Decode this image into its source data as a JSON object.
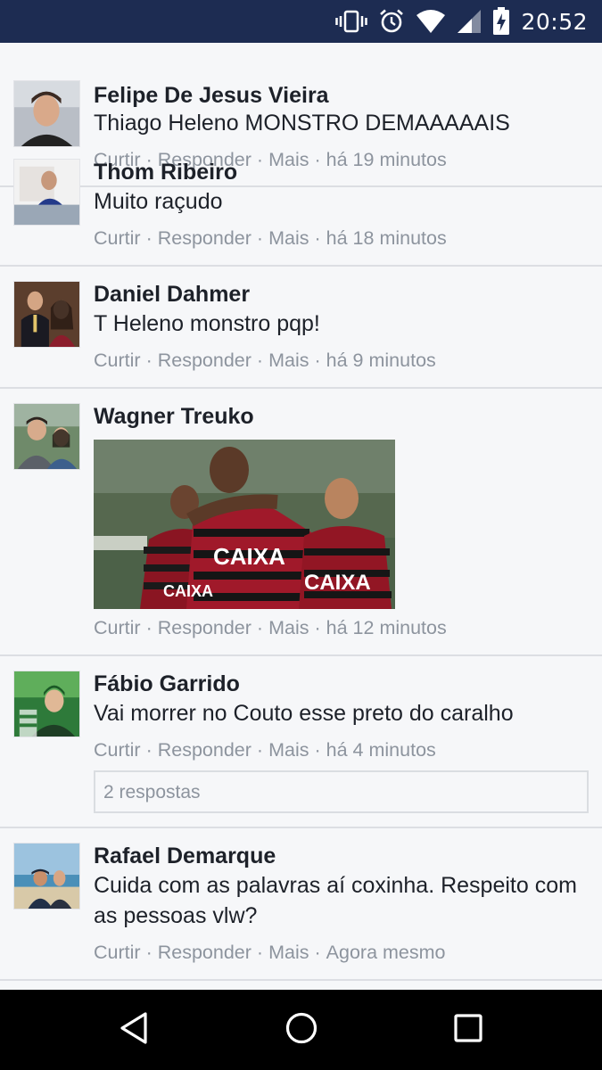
{
  "status_bar": {
    "time": "20:52",
    "icons": [
      "vibrate-icon",
      "alarm-icon",
      "wifi-icon",
      "signal-icon",
      "battery-charging-icon"
    ]
  },
  "comments": [
    {
      "name": "Felipe De Jesus Vieira",
      "text": "Thiago Heleno MONSTRO DEMAAAAAIS",
      "actions": {
        "like": "Curtir",
        "reply": "Responder",
        "more": "Mais",
        "separator": "·"
      },
      "time": "há 19 minutos"
    },
    {
      "name": "Thom Ribeiro",
      "text": "Muito raçudo",
      "actions": {
        "like": "Curtir",
        "reply": "Responder",
        "more": "Mais",
        "separator": "·"
      },
      "time": "há 18 minutos"
    },
    {
      "name": "Daniel Dahmer",
      "text": "T Heleno monstro pqp!",
      "actions": {
        "like": "Curtir",
        "reply": "Responder",
        "more": "Mais",
        "separator": "·"
      },
      "time": "há 9 minutos"
    },
    {
      "name": "Wagner Treuko",
      "photo_label": "CAIXA",
      "actions": {
        "like": "Curtir",
        "reply": "Responder",
        "more": "Mais",
        "separator": "·"
      },
      "time": "há 12 minutos"
    },
    {
      "name": "Fábio Garrido",
      "text": "Vai morrer no Couto esse preto do caralho",
      "actions": {
        "like": "Curtir",
        "reply": "Responder",
        "more": "Mais",
        "separator": "·"
      },
      "time": "há 4 minutos",
      "replies": "2 respostas"
    },
    {
      "name": "Rafael Demarque",
      "text": "Cuida com as palavras aí coxinha. Respeito com as pessoas vlw?",
      "actions": {
        "like": "Curtir",
        "reply": "Responder",
        "more": "Mais",
        "separator": "·"
      },
      "time": "Agora mesmo"
    }
  ],
  "nav_bar": {
    "buttons": [
      "back-icon",
      "home-icon",
      "recents-icon"
    ]
  },
  "colors": {
    "status_bar_bg": "#1d2c52",
    "page_bg": "#f6f7f9",
    "name_text": "#1d2129",
    "meta_text": "#8d949e",
    "divider": "#dcdee3"
  }
}
